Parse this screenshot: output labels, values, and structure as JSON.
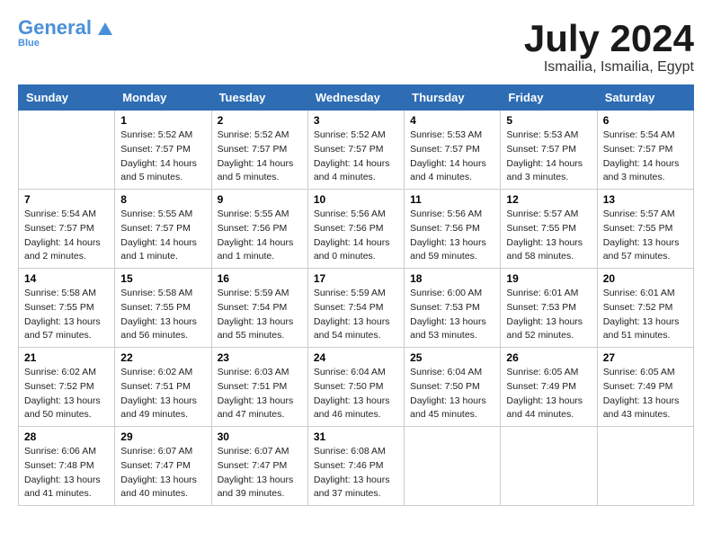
{
  "header": {
    "logo_line1": "General",
    "logo_line2": "Blue",
    "month_title": "July 2024",
    "location": "Ismailia, Ismailia, Egypt"
  },
  "weekdays": [
    "Sunday",
    "Monday",
    "Tuesday",
    "Wednesday",
    "Thursday",
    "Friday",
    "Saturday"
  ],
  "weeks": [
    [
      {
        "date": "",
        "sunrise": "",
        "sunset": "",
        "daylight": ""
      },
      {
        "date": "1",
        "sunrise": "Sunrise: 5:52 AM",
        "sunset": "Sunset: 7:57 PM",
        "daylight": "Daylight: 14 hours and 5 minutes."
      },
      {
        "date": "2",
        "sunrise": "Sunrise: 5:52 AM",
        "sunset": "Sunset: 7:57 PM",
        "daylight": "Daylight: 14 hours and 5 minutes."
      },
      {
        "date": "3",
        "sunrise": "Sunrise: 5:52 AM",
        "sunset": "Sunset: 7:57 PM",
        "daylight": "Daylight: 14 hours and 4 minutes."
      },
      {
        "date": "4",
        "sunrise": "Sunrise: 5:53 AM",
        "sunset": "Sunset: 7:57 PM",
        "daylight": "Daylight: 14 hours and 4 minutes."
      },
      {
        "date": "5",
        "sunrise": "Sunrise: 5:53 AM",
        "sunset": "Sunset: 7:57 PM",
        "daylight": "Daylight: 14 hours and 3 minutes."
      },
      {
        "date": "6",
        "sunrise": "Sunrise: 5:54 AM",
        "sunset": "Sunset: 7:57 PM",
        "daylight": "Daylight: 14 hours and 3 minutes."
      }
    ],
    [
      {
        "date": "7",
        "sunrise": "Sunrise: 5:54 AM",
        "sunset": "Sunset: 7:57 PM",
        "daylight": "Daylight: 14 hours and 2 minutes."
      },
      {
        "date": "8",
        "sunrise": "Sunrise: 5:55 AM",
        "sunset": "Sunset: 7:57 PM",
        "daylight": "Daylight: 14 hours and 1 minute."
      },
      {
        "date": "9",
        "sunrise": "Sunrise: 5:55 AM",
        "sunset": "Sunset: 7:56 PM",
        "daylight": "Daylight: 14 hours and 1 minute."
      },
      {
        "date": "10",
        "sunrise": "Sunrise: 5:56 AM",
        "sunset": "Sunset: 7:56 PM",
        "daylight": "Daylight: 14 hours and 0 minutes."
      },
      {
        "date": "11",
        "sunrise": "Sunrise: 5:56 AM",
        "sunset": "Sunset: 7:56 PM",
        "daylight": "Daylight: 13 hours and 59 minutes."
      },
      {
        "date": "12",
        "sunrise": "Sunrise: 5:57 AM",
        "sunset": "Sunset: 7:55 PM",
        "daylight": "Daylight: 13 hours and 58 minutes."
      },
      {
        "date": "13",
        "sunrise": "Sunrise: 5:57 AM",
        "sunset": "Sunset: 7:55 PM",
        "daylight": "Daylight: 13 hours and 57 minutes."
      }
    ],
    [
      {
        "date": "14",
        "sunrise": "Sunrise: 5:58 AM",
        "sunset": "Sunset: 7:55 PM",
        "daylight": "Daylight: 13 hours and 57 minutes."
      },
      {
        "date": "15",
        "sunrise": "Sunrise: 5:58 AM",
        "sunset": "Sunset: 7:55 PM",
        "daylight": "Daylight: 13 hours and 56 minutes."
      },
      {
        "date": "16",
        "sunrise": "Sunrise: 5:59 AM",
        "sunset": "Sunset: 7:54 PM",
        "daylight": "Daylight: 13 hours and 55 minutes."
      },
      {
        "date": "17",
        "sunrise": "Sunrise: 5:59 AM",
        "sunset": "Sunset: 7:54 PM",
        "daylight": "Daylight: 13 hours and 54 minutes."
      },
      {
        "date": "18",
        "sunrise": "Sunrise: 6:00 AM",
        "sunset": "Sunset: 7:53 PM",
        "daylight": "Daylight: 13 hours and 53 minutes."
      },
      {
        "date": "19",
        "sunrise": "Sunrise: 6:01 AM",
        "sunset": "Sunset: 7:53 PM",
        "daylight": "Daylight: 13 hours and 52 minutes."
      },
      {
        "date": "20",
        "sunrise": "Sunrise: 6:01 AM",
        "sunset": "Sunset: 7:52 PM",
        "daylight": "Daylight: 13 hours and 51 minutes."
      }
    ],
    [
      {
        "date": "21",
        "sunrise": "Sunrise: 6:02 AM",
        "sunset": "Sunset: 7:52 PM",
        "daylight": "Daylight: 13 hours and 50 minutes."
      },
      {
        "date": "22",
        "sunrise": "Sunrise: 6:02 AM",
        "sunset": "Sunset: 7:51 PM",
        "daylight": "Daylight: 13 hours and 49 minutes."
      },
      {
        "date": "23",
        "sunrise": "Sunrise: 6:03 AM",
        "sunset": "Sunset: 7:51 PM",
        "daylight": "Daylight: 13 hours and 47 minutes."
      },
      {
        "date": "24",
        "sunrise": "Sunrise: 6:04 AM",
        "sunset": "Sunset: 7:50 PM",
        "daylight": "Daylight: 13 hours and 46 minutes."
      },
      {
        "date": "25",
        "sunrise": "Sunrise: 6:04 AM",
        "sunset": "Sunset: 7:50 PM",
        "daylight": "Daylight: 13 hours and 45 minutes."
      },
      {
        "date": "26",
        "sunrise": "Sunrise: 6:05 AM",
        "sunset": "Sunset: 7:49 PM",
        "daylight": "Daylight: 13 hours and 44 minutes."
      },
      {
        "date": "27",
        "sunrise": "Sunrise: 6:05 AM",
        "sunset": "Sunset: 7:49 PM",
        "daylight": "Daylight: 13 hours and 43 minutes."
      }
    ],
    [
      {
        "date": "28",
        "sunrise": "Sunrise: 6:06 AM",
        "sunset": "Sunset: 7:48 PM",
        "daylight": "Daylight: 13 hours and 41 minutes."
      },
      {
        "date": "29",
        "sunrise": "Sunrise: 6:07 AM",
        "sunset": "Sunset: 7:47 PM",
        "daylight": "Daylight: 13 hours and 40 minutes."
      },
      {
        "date": "30",
        "sunrise": "Sunrise: 6:07 AM",
        "sunset": "Sunset: 7:47 PM",
        "daylight": "Daylight: 13 hours and 39 minutes."
      },
      {
        "date": "31",
        "sunrise": "Sunrise: 6:08 AM",
        "sunset": "Sunset: 7:46 PM",
        "daylight": "Daylight: 13 hours and 37 minutes."
      },
      {
        "date": "",
        "sunrise": "",
        "sunset": "",
        "daylight": ""
      },
      {
        "date": "",
        "sunrise": "",
        "sunset": "",
        "daylight": ""
      },
      {
        "date": "",
        "sunrise": "",
        "sunset": "",
        "daylight": ""
      }
    ]
  ]
}
